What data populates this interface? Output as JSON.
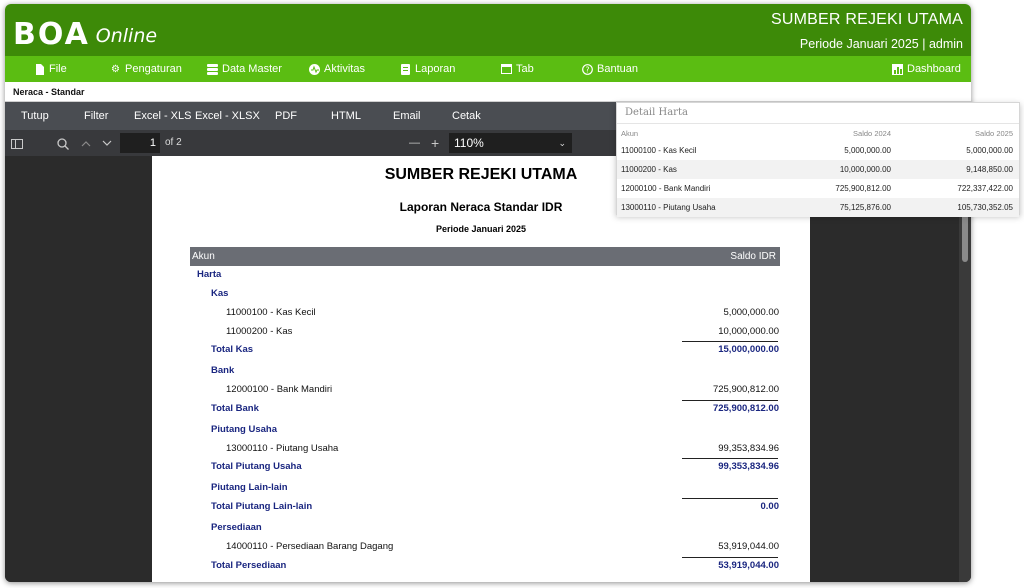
{
  "app": {
    "logo_mark": "BOA",
    "logo_sub": "Online",
    "company": "SUMBER REJEKI UTAMA",
    "period_user": "Periode Januari 2025 | admin",
    "brand_color": "#3d8a08",
    "menu_color": "#5bbd12"
  },
  "menu": [
    {
      "label": "File",
      "icon": "file-icon"
    },
    {
      "label": "Pengaturan",
      "icon": "gear-icon"
    },
    {
      "label": "Data Master",
      "icon": "database-icon"
    },
    {
      "label": "Aktivitas",
      "icon": "activity-icon"
    },
    {
      "label": "Laporan",
      "icon": "report-icon"
    },
    {
      "label": "Tab",
      "icon": "tab-icon"
    },
    {
      "label": "Bantuan",
      "icon": "help-icon"
    },
    {
      "label": "Dashboard",
      "icon": "dashboard-icon"
    }
  ],
  "breadcrumb": "Neraca - Standar",
  "export_bar": [
    "Tutup",
    "Filter",
    "Excel - XLS",
    "Excel - XLSX",
    "PDF",
    "HTML",
    "Email",
    "Cetak"
  ],
  "pdf_toolbar": {
    "page": "1",
    "page_total": "of 2",
    "zoom": "110%",
    "zoom_minus": "—",
    "zoom_plus": "+"
  },
  "report": {
    "company": "SUMBER REJEKI UTAMA",
    "title": "Laporan Neraca Standar IDR",
    "period": "Periode Januari  2025",
    "col_akun": "Akun",
    "col_saldo": "Saldo IDR",
    "rows": [
      {
        "kind": "grp",
        "level": 0,
        "label": "Harta"
      },
      {
        "kind": "grp",
        "level": 1,
        "label": "Kas"
      },
      {
        "kind": "item",
        "label": "11000100 - Kas Kecil",
        "amount": "5,000,000.00"
      },
      {
        "kind": "item",
        "label": "11000200 - Kas",
        "amount": "10,000,000.00"
      },
      {
        "kind": "tot",
        "label": "Total Kas",
        "amount": "15,000,000.00"
      },
      {
        "kind": "grp",
        "level": 1,
        "label": "Bank"
      },
      {
        "kind": "item",
        "label": "12000100 - Bank Mandiri",
        "amount": "725,900,812.00"
      },
      {
        "kind": "tot",
        "label": "Total Bank",
        "amount": "725,900,812.00"
      },
      {
        "kind": "grp",
        "level": 1,
        "label": "Piutang Usaha"
      },
      {
        "kind": "item",
        "label": "13000110 - Piutang Usaha",
        "amount": "99,353,834.96"
      },
      {
        "kind": "tot",
        "label": "Total Piutang Usaha",
        "amount": "99,353,834.96"
      },
      {
        "kind": "grp",
        "level": 1,
        "label": "Piutang Lain-lain"
      },
      {
        "kind": "tot",
        "label": "Total Piutang Lain-lain",
        "amount": "0.00"
      },
      {
        "kind": "grp",
        "level": 1,
        "label": "Persediaan"
      },
      {
        "kind": "item",
        "label": "14000110 - Persediaan Barang Dagang",
        "amount": "53,919,044.00"
      },
      {
        "kind": "tot",
        "label": "Total Persediaan",
        "amount": "53,919,044.00"
      }
    ]
  },
  "popup": {
    "title": "Detail Harta",
    "headers": [
      "Akun",
      "Saldo 2024",
      "Saldo 2025"
    ],
    "rows": [
      [
        "11000100 - Kas Kecil",
        "5,000,000.00",
        "5,000,000.00"
      ],
      [
        "11000200 - Kas",
        "10,000,000.00",
        "9,148,850.00"
      ],
      [
        "12000100 - Bank Mandiri",
        "725,900,812.00",
        "722,337,422.00"
      ],
      [
        "13000110 - Piutang Usaha",
        "75,125,876.00",
        "105,730,352.05"
      ]
    ]
  }
}
